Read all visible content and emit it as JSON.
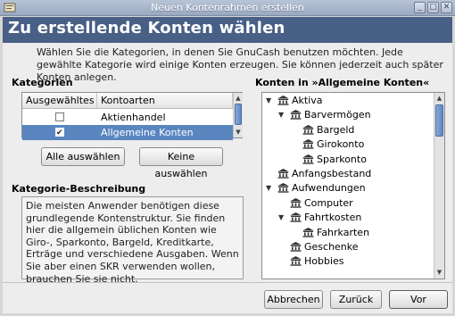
{
  "window": {
    "title": "Neuen Kontenrahmen erstellen"
  },
  "banner": {
    "title": "Zu erstellende Konten wählen"
  },
  "intro": "Wählen Sie die Kategorien, in denen Sie GnuCash benutzen möchten. Jede gewählte Kategorie wird einige Konten erzeugen. Sie können jederzeit auch später Konten anlegen.",
  "categories": {
    "label": "Kategorien",
    "col_selected": "Ausgewähltes",
    "col_types": "Kontoarten",
    "rows": [
      {
        "checked": false,
        "label": "Aktienhandel"
      },
      {
        "checked": true,
        "label": "Allgemeine Konten"
      }
    ],
    "select_all": "Alle auswählen",
    "select_none": "Keine auswählen"
  },
  "description": {
    "label": "Kategorie-Beschreibung",
    "text": "Die meisten Anwender benötigen diese grundlegende Kontenstruktur. Sie finden hier die allgemein üblichen Konten wie Giro-, Sparkonto, Bargeld, Kreditkarte, Erträge und verschiedene Ausgaben. Wenn Sie aber einen SKR verwenden wollen, brauchen Sie sie nicht."
  },
  "accounts": {
    "label": "Konten in »Allgemeine Konten«",
    "tree": [
      {
        "label": "Aktiva",
        "depth": 0,
        "expander": "open"
      },
      {
        "label": "Barvermögen",
        "depth": 1,
        "expander": "open"
      },
      {
        "label": "Bargeld",
        "depth": 2,
        "expander": "none"
      },
      {
        "label": "Girokonto",
        "depth": 2,
        "expander": "none"
      },
      {
        "label": "Sparkonto",
        "depth": 2,
        "expander": "none"
      },
      {
        "label": "Anfangsbestand",
        "depth": 0,
        "expander": "none"
      },
      {
        "label": "Aufwendungen",
        "depth": 0,
        "expander": "open"
      },
      {
        "label": "Computer",
        "depth": 1,
        "expander": "none"
      },
      {
        "label": "Fahrtkosten",
        "depth": 1,
        "expander": "open"
      },
      {
        "label": "Fahrkarten",
        "depth": 2,
        "expander": "none"
      },
      {
        "label": "Geschenke",
        "depth": 1,
        "expander": "none"
      },
      {
        "label": "Hobbies",
        "depth": 1,
        "expander": "none"
      }
    ]
  },
  "buttons": {
    "cancel": "Abbrechen",
    "back": "Zurück",
    "forward": "Vor"
  },
  "colors": {
    "banner": "#485f86",
    "selection": "#5a86c0"
  }
}
